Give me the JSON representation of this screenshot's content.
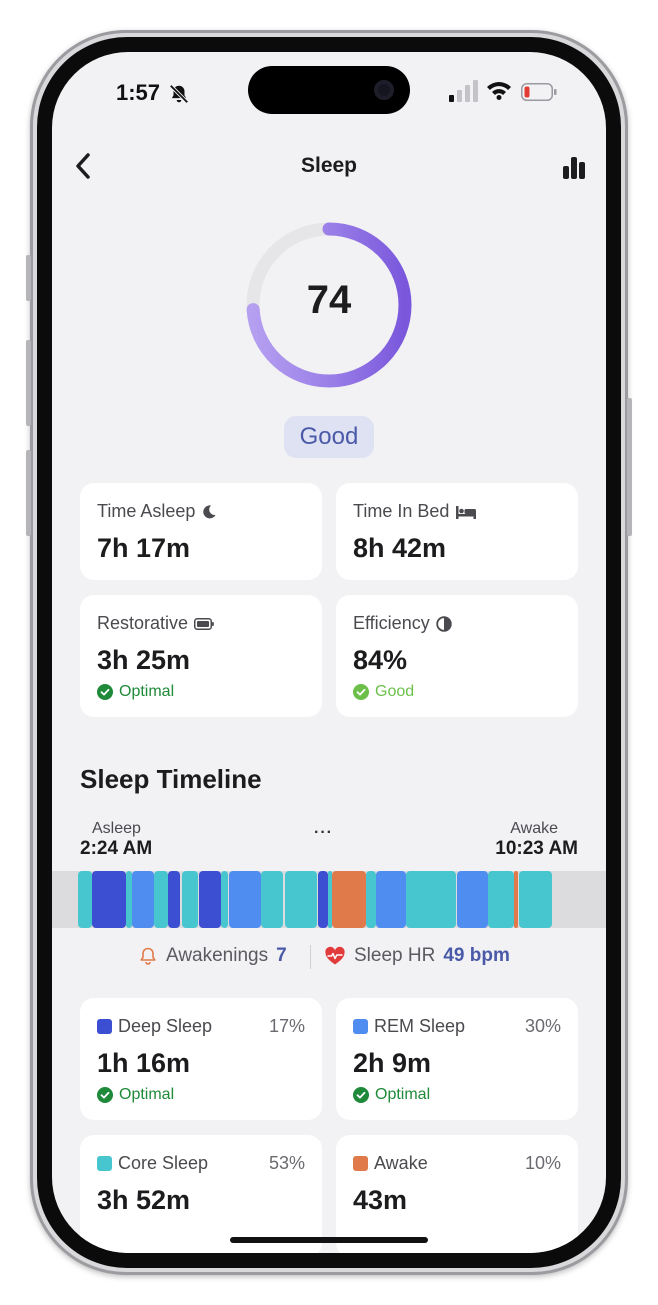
{
  "status_bar": {
    "time": "1:57"
  },
  "nav": {
    "title": "Sleep"
  },
  "score": {
    "value": "74",
    "label": "Good",
    "fraction": 0.74
  },
  "stats": [
    {
      "label": "Time Asleep",
      "value": "7h 17m",
      "icon": "moon-icon"
    },
    {
      "label": "Time In Bed",
      "value": "8h 42m",
      "icon": "bed-icon"
    },
    {
      "label": "Restorative",
      "value": "3h 25m",
      "icon": "battery-icon",
      "status": "Optimal",
      "status_color": "#1f8a3a"
    },
    {
      "label": "Efficiency",
      "value": "84%",
      "icon": "half-circle-icon",
      "status": "Good",
      "status_color": "#6cc04a"
    }
  ],
  "timeline": {
    "title": "Sleep Timeline",
    "start_label": "Asleep",
    "start_time": "2:24 AM",
    "end_label": "Awake",
    "end_time": "10:23 AM",
    "more": "···",
    "colors": {
      "deep": "#3c4fd2",
      "rem": "#4f8ef0",
      "core": "#48c6d0",
      "awake": "#e07a4a"
    }
  },
  "summary": {
    "awakenings_label": "Awakenings",
    "awakenings_value": "7",
    "hr_label": "Sleep HR",
    "hr_value": "49 bpm"
  },
  "stages": [
    {
      "name": "Deep Sleep",
      "percent": "17%",
      "value": "1h 16m",
      "status": "Optimal",
      "color": "#3c4fd2"
    },
    {
      "name": "REM Sleep",
      "percent": "30%",
      "value": "2h 9m",
      "status": "Optimal",
      "color": "#4f8ef0"
    },
    {
      "name": "Core Sleep",
      "percent": "53%",
      "value": "3h 52m",
      "color": "#48c6d0"
    },
    {
      "name": "Awake",
      "percent": "10%",
      "value": "43m",
      "color": "#e07a4a"
    }
  ]
}
